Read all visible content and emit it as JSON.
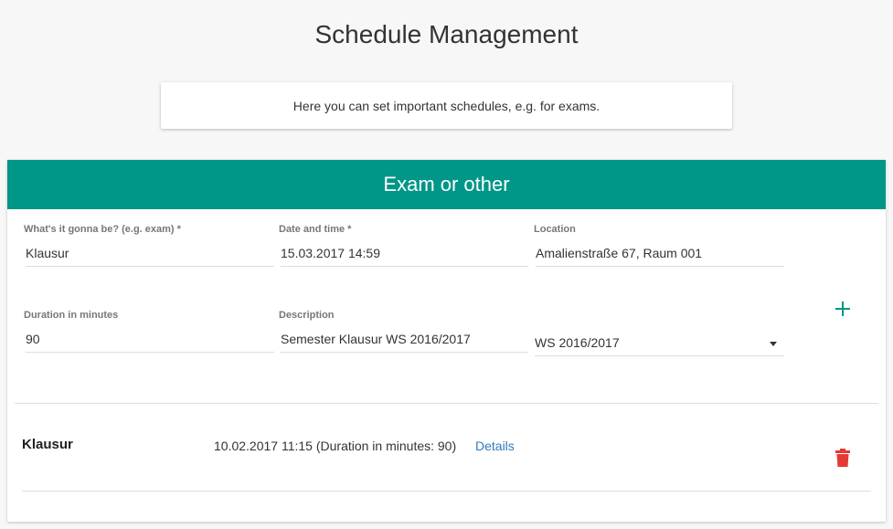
{
  "page": {
    "title": "Schedule Management",
    "info": "Here you can set important schedules, e.g. for exams."
  },
  "panel": {
    "title": "Exam or other",
    "accent_color": "#009688",
    "form": {
      "what": {
        "label": "What's it gonna be? (e.g. exam) *",
        "value": "Klausur"
      },
      "datetime": {
        "label": "Date and time *",
        "value": "15.03.2017 14:59"
      },
      "location": {
        "label": "Location",
        "value": "Amalienstraße 67, Raum 001"
      },
      "duration": {
        "label": "Duration in minutes",
        "value": "90"
      },
      "description": {
        "label": "Description",
        "value": "Semester Klausur WS 2016/2017"
      },
      "semester": {
        "value": "WS 2016/2017"
      }
    },
    "add_icon": "plus-icon",
    "entries": [
      {
        "title": "Klausur",
        "meta": "10.02.2017 11:15 (Duration in minutes: 90)",
        "link": "Details",
        "delete_icon": "trash-icon",
        "delete_color": "#e53935"
      }
    ]
  }
}
